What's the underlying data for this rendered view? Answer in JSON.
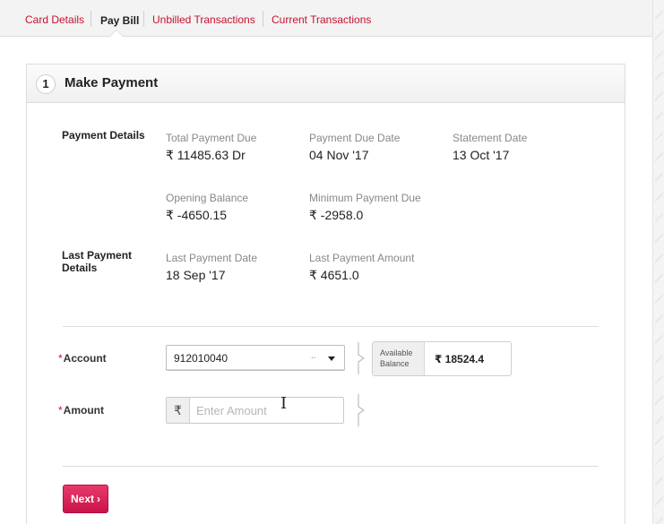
{
  "tabs": [
    {
      "label": "Card Details"
    },
    {
      "label": "Pay Bill",
      "active": true
    },
    {
      "label": "Unbilled Transactions"
    },
    {
      "label": "Current Transactions"
    }
  ],
  "panel": {
    "step_number": "1",
    "title": "Make Payment"
  },
  "payment_details": {
    "section_label": "Payment Details",
    "total_payment_due": {
      "label": "Total Payment Due",
      "value": "₹ 11485.63 Dr"
    },
    "payment_due_date": {
      "label": "Payment Due Date",
      "value": "04 Nov '17"
    },
    "statement_date": {
      "label": "Statement Date",
      "value": "13 Oct '17"
    },
    "opening_balance": {
      "label": "Opening Balance",
      "value": "₹ -4650.15"
    },
    "minimum_payment_due": {
      "label": "Minimum Payment Due",
      "value": "₹ -2958.0"
    }
  },
  "last_payment": {
    "section_label_line1": "Last Payment",
    "section_label_line2": "Details",
    "date": {
      "label": "Last Payment Date",
      "value": "18 Sep '17"
    },
    "amount": {
      "label": "Last Payment Amount",
      "value": "₹ 4651.0"
    }
  },
  "form": {
    "required_mark": "*",
    "account_label": "Account",
    "account_value": "912010040",
    "account_dots": "..",
    "available_balance_line1": "Available",
    "available_balance_line2": "Balance",
    "available_balance_value": "₹ 18524.4",
    "amount_label": "Amount",
    "currency_symbol": "₹",
    "amount_placeholder": "Enter Amount",
    "next_label": "Next",
    "next_chevron": "›"
  },
  "colors": {
    "accent": "#c8102e",
    "button": "#d81b55"
  }
}
